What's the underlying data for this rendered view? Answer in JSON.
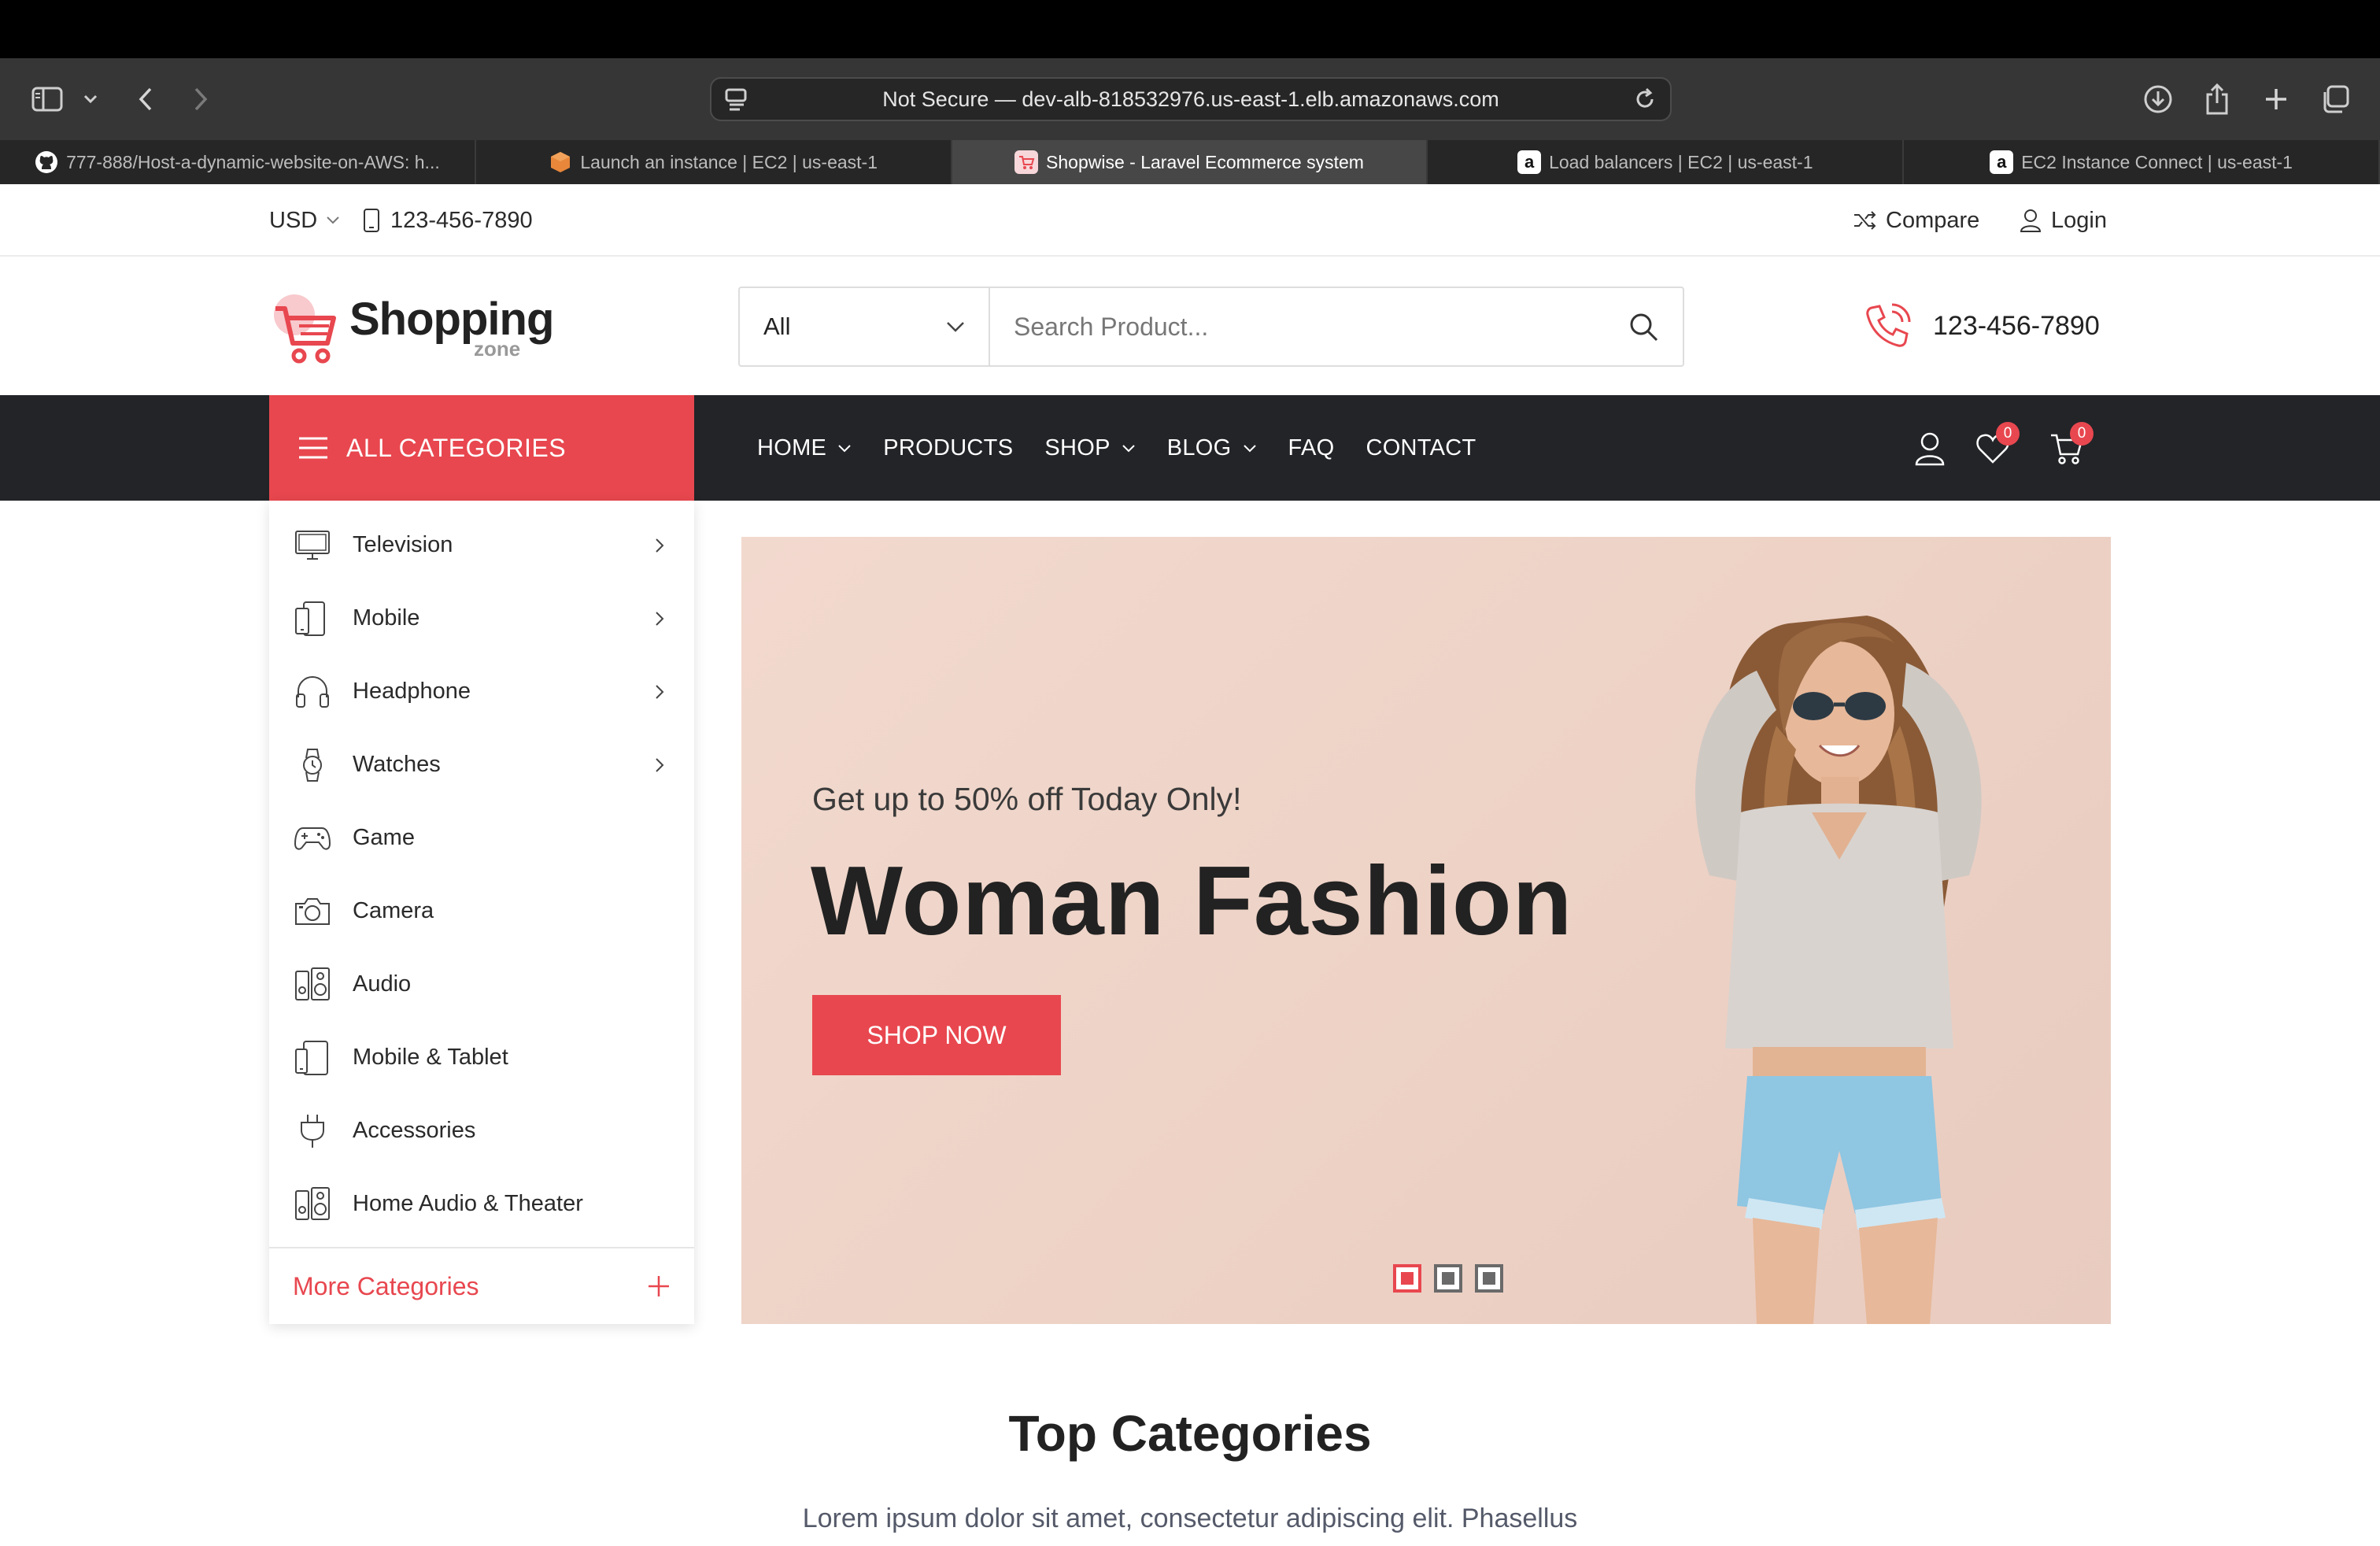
{
  "browser": {
    "url_text": "Not Secure — dev-alb-818532976.us-east-1.elb.amazonaws.com",
    "tabs": [
      {
        "title": "777-888/Host-a-dynamic-website-on-AWS: h...",
        "icon": "github-icon",
        "active": false
      },
      {
        "title": "Launch an instance | EC2 | us-east-1",
        "icon": "aws-ec2-icon",
        "active": false
      },
      {
        "title": "Shopwise - Laravel Ecommerce system",
        "icon": "shopwise-icon",
        "active": true
      },
      {
        "title": "Load balancers | EC2 | us-east-1",
        "icon": "amazon-icon",
        "active": false
      },
      {
        "title": "EC2 Instance Connect | us-east-1",
        "icon": "amazon-icon",
        "active": false
      }
    ]
  },
  "topbar": {
    "currency": "USD",
    "phone": "123-456-7890",
    "compare": "Compare",
    "login": "Login"
  },
  "header": {
    "logo_main": "Shopping",
    "logo_sub": "zone",
    "category_select": "All",
    "search_placeholder": "Search Product...",
    "phone": "123-456-7890"
  },
  "nav": {
    "all_categories": "ALL CATEGORIES",
    "links": [
      {
        "label": "HOME",
        "dropdown": true
      },
      {
        "label": "PRODUCTS",
        "dropdown": false
      },
      {
        "label": "SHOP",
        "dropdown": true
      },
      {
        "label": "BLOG",
        "dropdown": true
      },
      {
        "label": "FAQ",
        "dropdown": false
      },
      {
        "label": "CONTACT",
        "dropdown": false
      }
    ],
    "wishlist_count": "0",
    "cart_count": "0"
  },
  "categories": {
    "items": [
      {
        "label": "Television",
        "icon": "television-icon",
        "submenu": true
      },
      {
        "label": "Mobile",
        "icon": "mobile-icon",
        "submenu": true
      },
      {
        "label": "Headphone",
        "icon": "headphone-icon",
        "submenu": true
      },
      {
        "label": "Watches",
        "icon": "watch-icon",
        "submenu": true
      },
      {
        "label": "Game",
        "icon": "gamepad-icon",
        "submenu": false
      },
      {
        "label": "Camera",
        "icon": "camera-icon",
        "submenu": false
      },
      {
        "label": "Audio",
        "icon": "speaker-icon",
        "submenu": false
      },
      {
        "label": "Mobile & Tablet",
        "icon": "tablet-icon",
        "submenu": false
      },
      {
        "label": "Accessories",
        "icon": "plug-icon",
        "submenu": false
      },
      {
        "label": "Home Audio & Theater",
        "icon": "speaker-icon",
        "submenu": false
      }
    ],
    "more": "More Categories"
  },
  "banner": {
    "tagline": "Get up to 50% off Today Only!",
    "heading": "Woman Fashion",
    "button": "SHOP NOW",
    "slide_count": 3,
    "active_slide": 1
  },
  "section": {
    "title": "Top Categories",
    "description": "Lorem ipsum dolor sit amet, consectetur adipiscing elit. Phasellus"
  },
  "colors": {
    "accent": "#e8474f",
    "navbar": "#222428",
    "browser_chrome": "#363636"
  }
}
